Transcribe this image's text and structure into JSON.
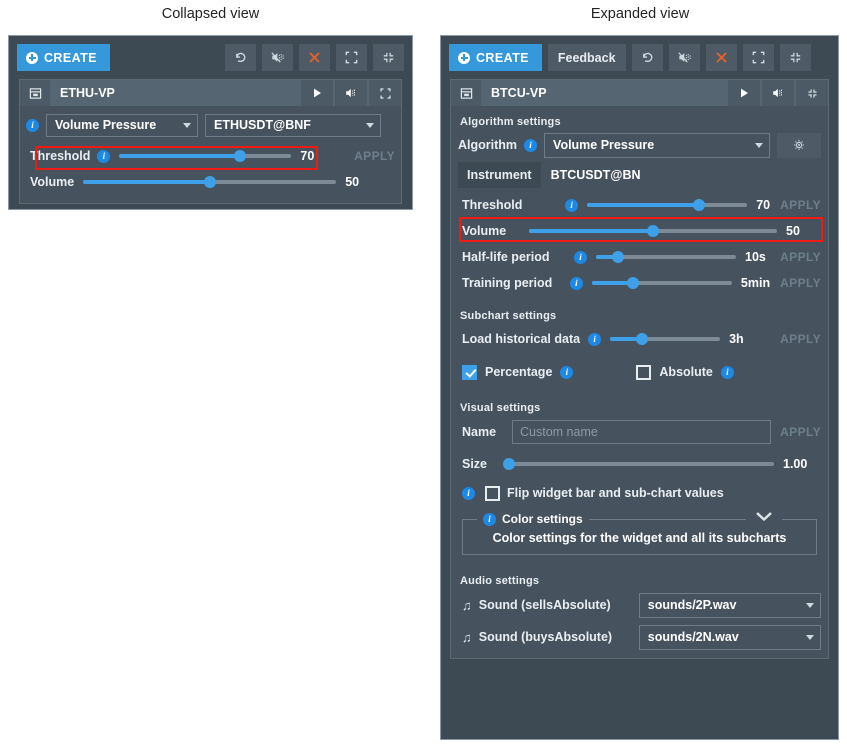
{
  "captions": {
    "collapsed": "Collapsed view",
    "expanded": "Expanded view"
  },
  "colors": {
    "accent": "#3498db",
    "slider": "#3ea0e8",
    "panel_bg": "#3d4a54",
    "card_bg": "#46525d",
    "highlight": "#f01b12",
    "close_icon": "#e8622a"
  },
  "collapsed": {
    "toolbar": {
      "create_label": "CREATE",
      "buttons": [
        {
          "name": "undo-icon",
          "title": "Undo"
        },
        {
          "name": "mute-all-icon",
          "title": "Mute all"
        },
        {
          "name": "close-icon",
          "title": "Close"
        },
        {
          "name": "expand-all-icon",
          "title": "Expand all"
        },
        {
          "name": "collapse-all-icon",
          "title": "Collapse all"
        }
      ]
    },
    "widget": {
      "title": "ETHU-VP",
      "header_buttons": [
        {
          "name": "play-icon"
        },
        {
          "name": "mute-icon"
        },
        {
          "name": "expand-icon"
        }
      ],
      "algorithm": "Volume Pressure",
      "instrument": "ETHUSDT@BNF",
      "threshold": {
        "label": "Threshold",
        "value": "70",
        "percent": 70,
        "apply": "APPLY"
      },
      "volume": {
        "label": "Volume",
        "value": "50",
        "percent": 50
      }
    }
  },
  "expanded": {
    "toolbar": {
      "create_label": "CREATE",
      "feedback_label": "Feedback",
      "buttons": [
        {
          "name": "undo-icon",
          "title": "Undo"
        },
        {
          "name": "mute-all-icon",
          "title": "Mute all"
        },
        {
          "name": "close-icon",
          "title": "Close"
        },
        {
          "name": "expand-all-icon",
          "title": "Expand all"
        },
        {
          "name": "collapse-all-icon",
          "title": "Collapse all"
        }
      ]
    },
    "widget": {
      "title": "BTCU-VP",
      "header_buttons": [
        {
          "name": "play-icon"
        },
        {
          "name": "mute-icon"
        },
        {
          "name": "collapse-icon"
        }
      ],
      "algorithm_settings": {
        "section_title": "Algorithm settings",
        "algorithm_label": "Algorithm",
        "algorithm_value": "Volume Pressure",
        "gear_title": "Algorithm options",
        "instrument_label": "Instrument",
        "instrument_value": "BTCUSDT@BN",
        "sliders": [
          {
            "label": "Threshold",
            "value": "70",
            "percent": 70,
            "apply": "APPLY",
            "info": true
          },
          {
            "label": "Volume",
            "value": "50",
            "percent": 50,
            "apply": "",
            "info": false
          },
          {
            "label": "Half-life period",
            "value": "10s",
            "percent": 16,
            "apply": "APPLY",
            "info": true
          },
          {
            "label": "Training period",
            "value": "5min",
            "percent": 29,
            "apply": "APPLY",
            "info": true
          }
        ]
      },
      "subchart_settings": {
        "section_title": "Subchart settings",
        "load_historical": {
          "label": "Load historical data",
          "value": "3h",
          "percent": 29,
          "apply": "APPLY"
        },
        "percentage": {
          "label": "Percentage",
          "checked": true
        },
        "absolute": {
          "label": "Absolute",
          "checked": false
        }
      },
      "visual_settings": {
        "section_title": "Visual settings",
        "name_label": "Name",
        "name_value": "",
        "name_placeholder": "Custom name",
        "name_apply": "APPLY",
        "size": {
          "label": "Size",
          "value": "1.00",
          "percent": 2
        },
        "flip": {
          "label": "Flip widget bar and sub-chart values",
          "checked": false
        },
        "color_settings": {
          "legend": "Color settings",
          "body": "Color settings for the widget and all its subcharts",
          "chevron": "chevron-down-icon"
        }
      },
      "audio_settings": {
        "section_title": "Audio settings",
        "rows": [
          {
            "label": "Sound (sellsAbsolute)",
            "value": "sounds/2P.wav"
          },
          {
            "label": "Sound (buysAbsolute)",
            "value": "sounds/2N.wav"
          }
        ]
      }
    }
  }
}
